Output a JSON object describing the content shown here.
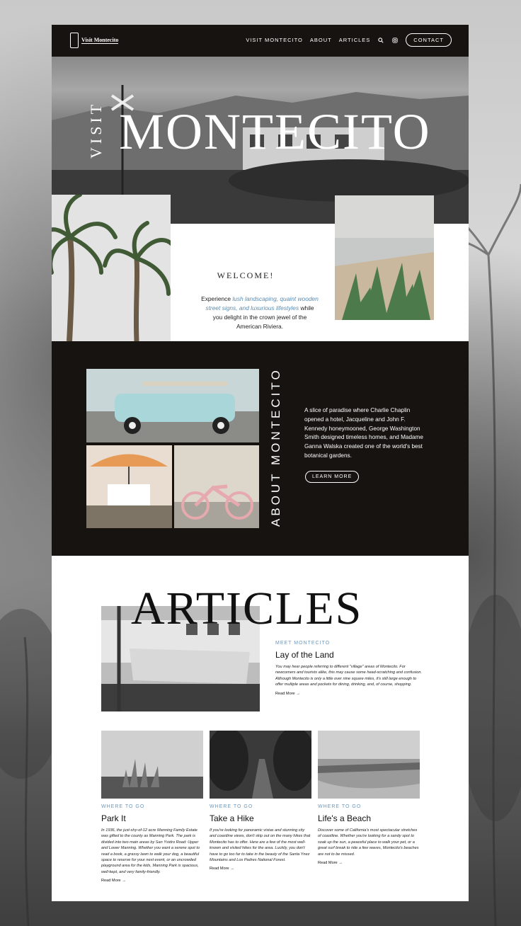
{
  "nav": {
    "logo_text": "Visit Montecito",
    "links": [
      "VISIT MONTECITO",
      "ABOUT",
      "ARTICLES"
    ],
    "contact_label": "CONTACT",
    "icons": [
      "search-icon",
      "instagram-icon"
    ]
  },
  "hero": {
    "visit": "VISIT",
    "title": "MONTECITO"
  },
  "welcome": {
    "heading": "WELCOME!",
    "body_start": "Experience ",
    "body_highlight": "lush landscaping, quaint wooden street signs, and luxurious lifestyles",
    "body_end": " while you delight in the crown jewel of the American Riviera."
  },
  "about": {
    "title": "ABOUT MONTECITO",
    "body": "A slice of paradise where Charlie Chaplin opened a hotel, Jacqueline and John F. Kennedy honeymooned, George Washington Smith designed timeless homes, and Madame Ganna Walska created one of the world's best botanical gardens.",
    "button_label": "LEARN MORE"
  },
  "articles": {
    "title": "ARTICLES",
    "featured": {
      "eyebrow": "MEET MONTECITO",
      "title": "Lay of the Land",
      "body": "You may hear people referring to different \"village\" areas of Montecito. For newcomers and tourists alike, this may cause some head-scratching and confusion. Although Montecito is only a little over nine square miles, it's still large enough to offer multiple areas and pockets for dining, drinking, and, of course, shopping.",
      "read_more": "Read More →"
    },
    "cards": [
      {
        "eyebrow": "WHERE TO GO",
        "title": "Park It",
        "body": "In 1936, the just-shy-of-12 acre Manning Family Estate was gifted to the county as Manning Park. The park is divided into two main areas by San Ysidro Road: Upper and Lower Manning. Whether you want a serene spot to read a book, a grassy lawn to walk your dog, a beautiful space to reserve for your next event, or an uncrowded playground area for the kids, Manning Park is spacious, well-kept, and very family-friendly.",
        "read_more": "Read More →"
      },
      {
        "eyebrow": "WHERE TO GO",
        "title": "Take a Hike",
        "body": "If you're looking for panoramic vistas and stunning city and coastline views, don't skip out on the many hikes that Montecito has to offer. Here are a few of the most well-known and visited hikes for the area. Luckily, you don't have to go too far to take in the beauty of the Santa Ynez Mountains and Los Padres National Forest.",
        "read_more": "Read More →"
      },
      {
        "eyebrow": "WHERE TO GO",
        "title": "Life's a Beach",
        "body": "Discover some of California's most spectacular stretches of coastline. Whether you're looking for a sandy spot to soak up the sun, a peaceful place to walk your pet, or a great surf break to ride a few waves, Montecito's beaches are not to be missed.",
        "read_more": "Read More →"
      }
    ]
  },
  "colors": {
    "dark": "#161310",
    "accent": "#6d97bb",
    "highlight": "#5a8bb0"
  }
}
